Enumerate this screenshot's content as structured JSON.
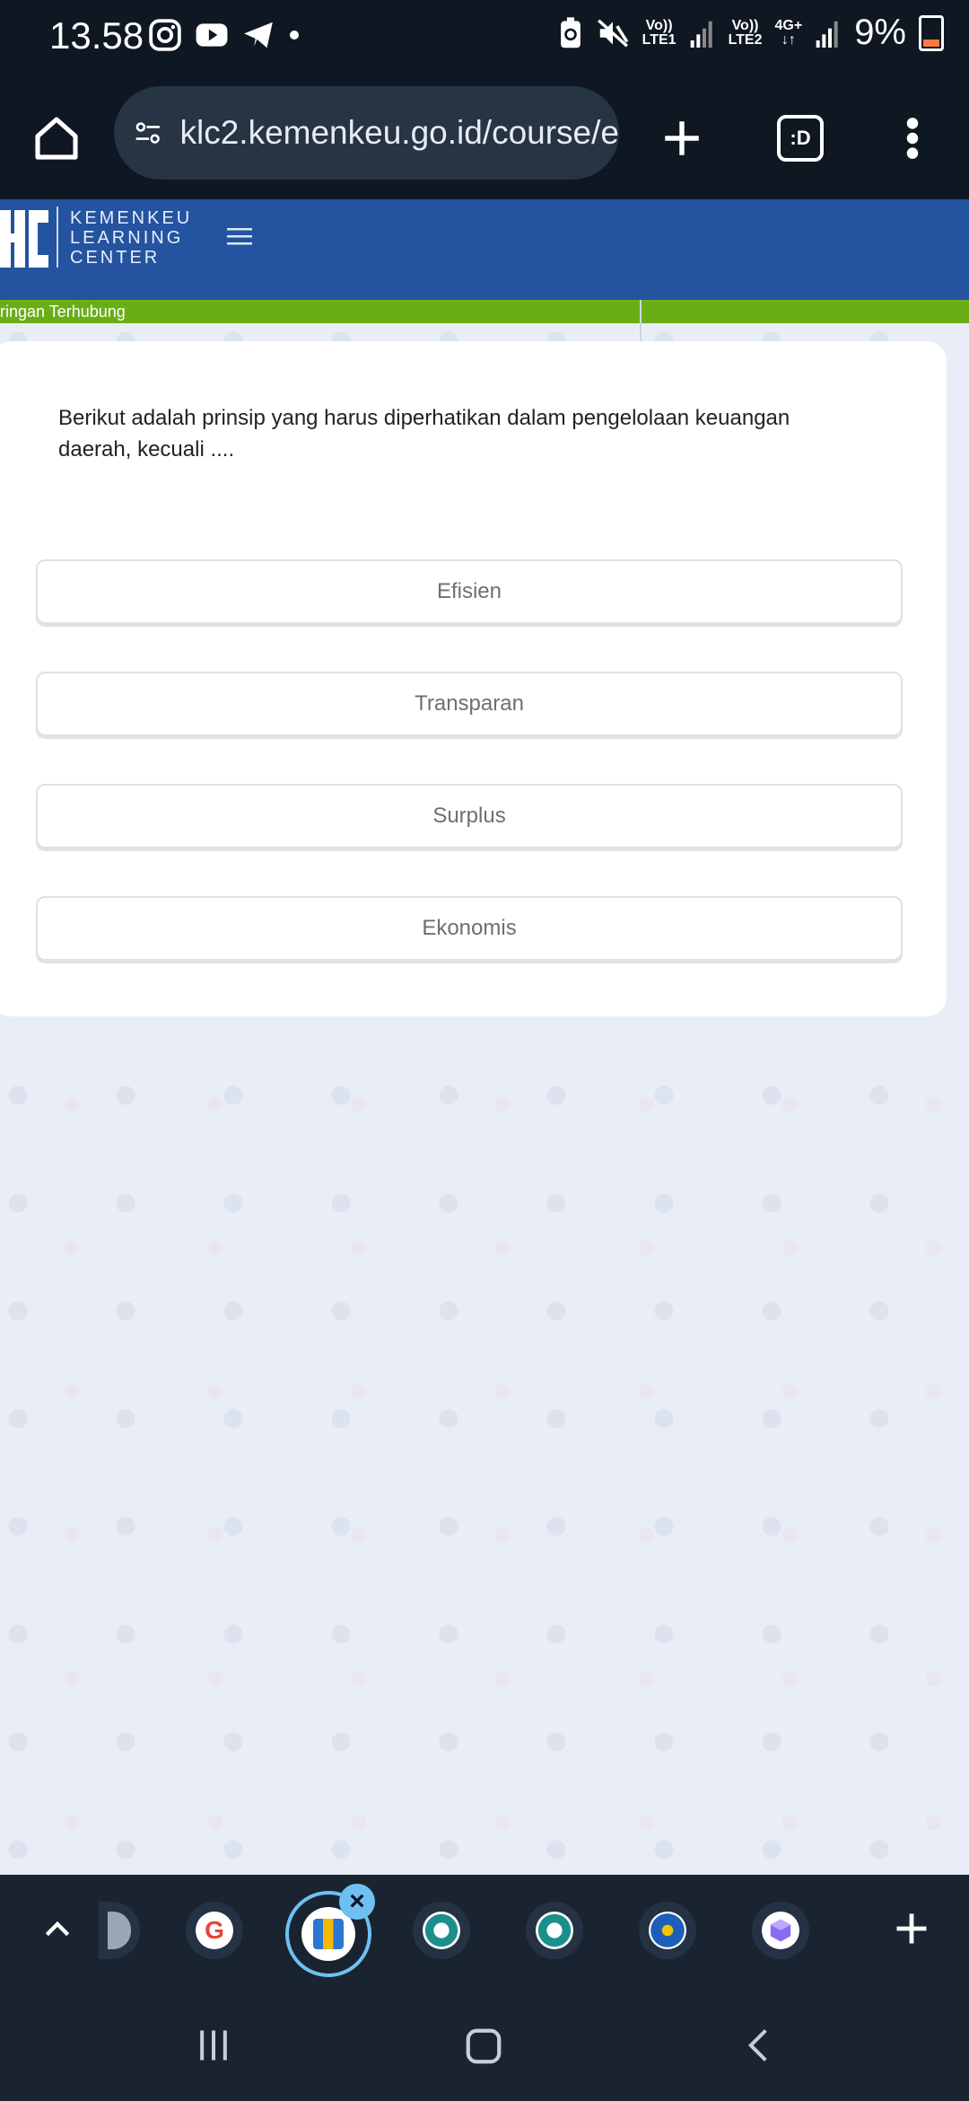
{
  "status_bar": {
    "time": "13.58",
    "battery": "9%",
    "sim1_top": "Vo))",
    "sim1_bottom": "LTE1",
    "sim2_top": "Vo))",
    "sim2_bottom": "LTE2",
    "net_top": "4G+",
    "net_bottom": "↓↑"
  },
  "browser": {
    "url": "klc2.kemenkeu.go.id/course/e",
    "tab_switcher_label": ":D"
  },
  "site": {
    "logo_line1": "KEMENKEU",
    "logo_line2": "LEARNING",
    "logo_line3": "CENTER",
    "connection_status": "ringan Terhubung",
    "brand_color": "#2453a0",
    "status_color": "#6aae17"
  },
  "quiz": {
    "question": "Berikut adalah prinsip yang harus diperhatikan dalam pengelolaan keuangan daerah, kecuali ....",
    "options": [
      "Efisien",
      "Transparan",
      "Surplus",
      "Ekonomis"
    ]
  },
  "tab_bar": {
    "tabs": [
      {
        "icon": "partial-tab-icon"
      },
      {
        "icon": "google-icon"
      },
      {
        "icon": "klc-icon",
        "active": true
      },
      {
        "icon": "circular-logo-icon"
      },
      {
        "icon": "circular-logo-icon"
      },
      {
        "icon": "kemendikbud-icon"
      },
      {
        "icon": "hexagon-app-icon"
      }
    ]
  }
}
